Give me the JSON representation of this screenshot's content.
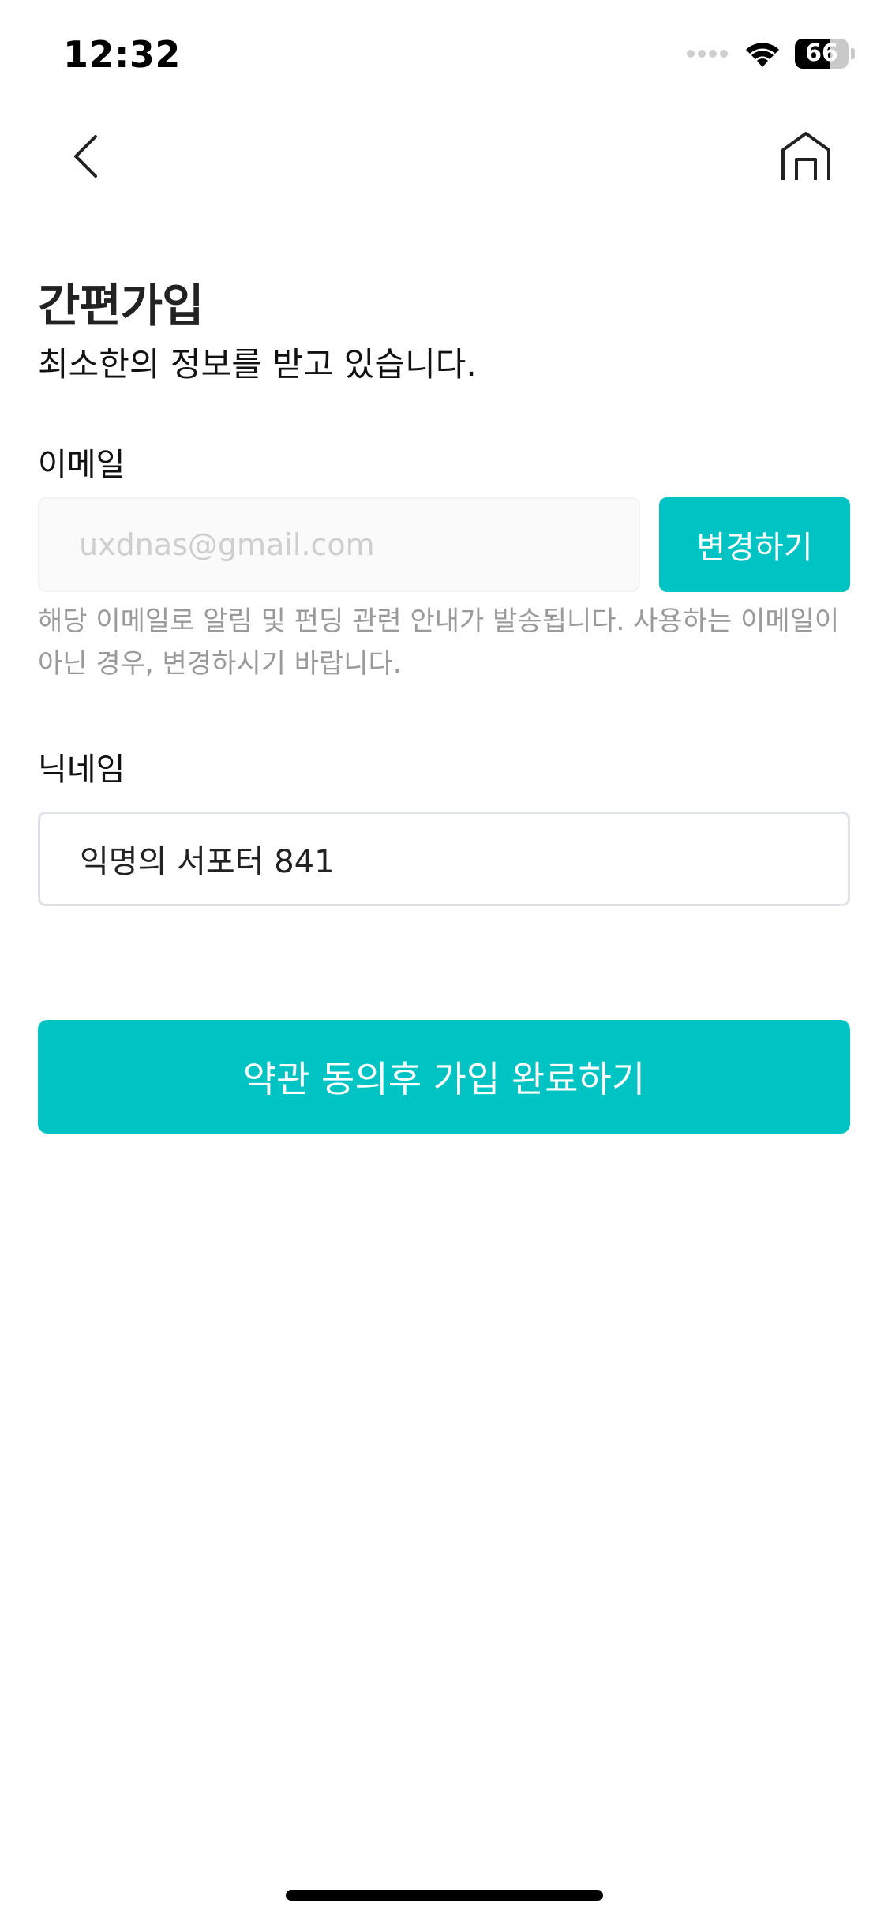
{
  "status_bar": {
    "time": "12:32",
    "battery_level": "66",
    "battery_fraction": 0.66
  },
  "nav": {
    "back_icon": "chevron-left-icon",
    "home_icon": "home-icon"
  },
  "header": {
    "title": "간편가입",
    "subtitle": "최소한의 정보를 받고 있습니다."
  },
  "email": {
    "label": "이메일",
    "placeholder": "uxdnas@gmail.com",
    "value": "",
    "change_label": "변경하기",
    "help_text": "해당 이메일로 알림 및 펀딩 관련 안내가 발송됩니다. 사용하는 이메일이 아닌 경우, 변경하시기 바랍니다."
  },
  "nickname": {
    "label": "닉네임",
    "value": "익명의 서포터 841"
  },
  "submit": {
    "label": "약관 동의후 가입 완료하기"
  },
  "colors": {
    "accent": "#00c4c4",
    "text_primary": "#111111",
    "text_muted": "#9a9a9a",
    "input_border": "#dde3e8"
  }
}
